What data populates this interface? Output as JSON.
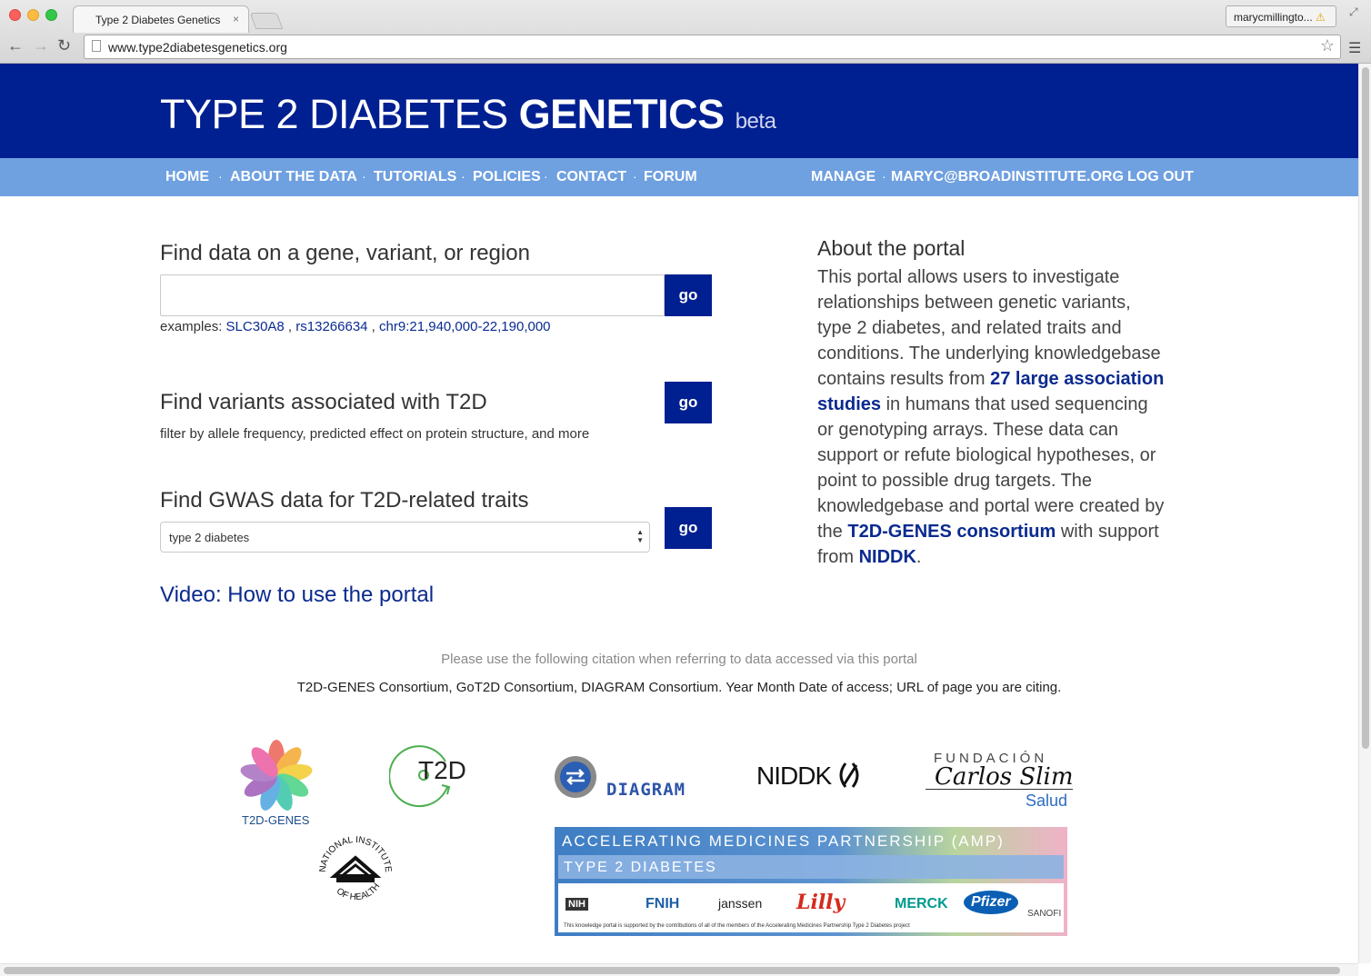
{
  "browser": {
    "tab_title": "Type 2 Diabetes Genetics",
    "tab_close": "×",
    "url": "www.type2diabetesgenetics.org",
    "user_badge": "marycmillingto...",
    "warning_glyph": "⚠"
  },
  "header": {
    "title_light": "TYPE 2 DIABETES ",
    "title_bold": "GENETICS",
    "title_beta": "beta"
  },
  "nav": {
    "left": [
      "HOME",
      "ABOUT THE DATA",
      "TUTORIALS",
      "POLICIES",
      "CONTACT",
      "FORUM"
    ],
    "separator": "·",
    "manage": "MANAGE",
    "email": "MARYC@BROADINSTITUTE.ORG",
    "logout": "LOG OUT"
  },
  "search": {
    "heading": "Find data on a gene, variant, or region",
    "input_value": "",
    "go_label": "go",
    "examples_prefix": "examples: ",
    "examples": [
      "SLC30A8",
      "rs13266634",
      "chr9:21,940,000-22,190,000"
    ],
    "examples_sep": " , "
  },
  "variants": {
    "heading": "Find variants associated with T2D",
    "subtext": "filter by allele frequency, predicted effect on protein structure, and more",
    "go_label": "go"
  },
  "gwas": {
    "heading": "Find GWAS data for T2D-related traits",
    "selected": "type 2 diabetes",
    "go_label": "go"
  },
  "video_link": "Video: How to use the portal",
  "about": {
    "title": "About the portal",
    "p1": "This portal allows users to investigate relationships between genetic variants, type 2 diabetes, and related traits and conditions. The underlying knowledgebase contains results from ",
    "link1": "27 large association studies",
    "p2": " in humans that used sequencing or genotyping arrays. These data can support or refute biological hypotheses, or point to possible drug targets. The knowledgebase and portal were created by the ",
    "link2": "T2D-GENES consortium",
    "p3": " with support from ",
    "link3": "NIDDK",
    "p4": "."
  },
  "citation": {
    "note": "Please use the following citation when referring to data accessed via this portal",
    "text": "T2D-GENES Consortium, GoT2D Consortium, DIAGRAM Consortium. Year Month Date of access; URL of page you are citing."
  },
  "logos": {
    "t2dgenes": "T2D-GENES",
    "got2d": "T2D",
    "diagram": "DIAGRAM",
    "niddk": "NIDDK",
    "fundacion_top": "FUNDACIÓN",
    "fundacion_mid": "Carlos Slim",
    "fundacion_bottom": "Salud",
    "nih_top": "NATIONAL INSTITUTES",
    "nih_bottom": "OF HEALTH",
    "amp_title": "ACCELERATING MEDICINES PARTNERSHIP (AMP)",
    "amp_sub": "TYPE 2 DIABETES",
    "amp_partners": [
      "NIH",
      "FNIH",
      "janssen",
      "Lilly",
      "MERCK",
      "Pfizer",
      "SANOFI"
    ],
    "amp_footer": "This knowledge portal is supported by the contributions of all of the members of the Accelerating Medicines Partnership Type 2 Diabetes project"
  },
  "colors": {
    "brand_navy": "#001f91",
    "nav_blue": "#6fa0e0",
    "link": "#0a2a8f"
  }
}
